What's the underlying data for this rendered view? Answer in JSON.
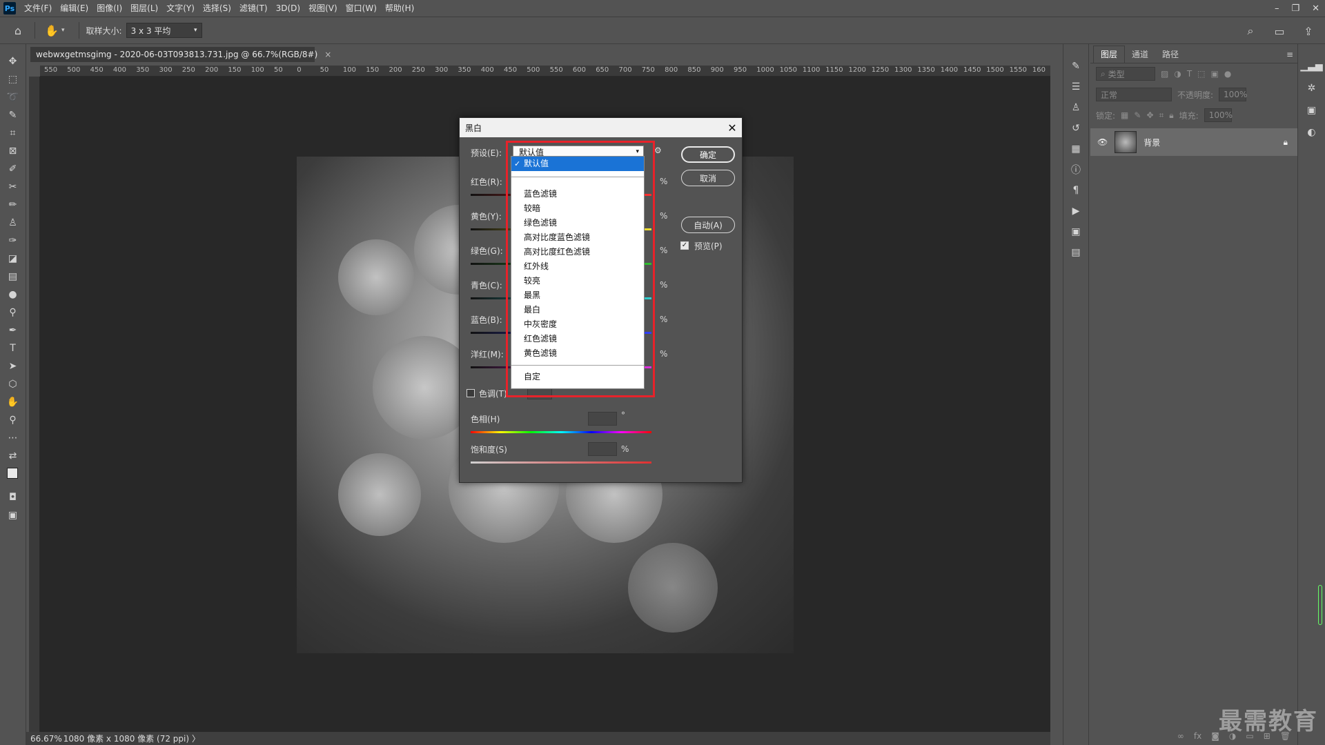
{
  "app": {
    "logo": "Ps",
    "menus": [
      "文件(F)",
      "编辑(E)",
      "图像(I)",
      "图层(L)",
      "文字(Y)",
      "选择(S)",
      "滤镜(T)",
      "3D(D)",
      "视图(V)",
      "窗口(W)",
      "帮助(H)"
    ]
  },
  "options": {
    "sample_size_label": "取样大小:",
    "sample_size_value": "3 x 3 平均"
  },
  "document": {
    "tab_title": "webwxgetmsgimg - 2020-06-03T093813.731.jpg @ 66.7%(RGB/8#)",
    "close_glyph": "×",
    "ruler_ticks": [
      "550",
      "500",
      "450",
      "400",
      "350",
      "300",
      "250",
      "200",
      "150",
      "100",
      "50",
      "0",
      "50",
      "100",
      "150",
      "200",
      "250",
      "300",
      "350",
      "400",
      "450",
      "500",
      "550",
      "600",
      "650",
      "700",
      "750",
      "800",
      "850",
      "900",
      "950",
      "1000",
      "1050",
      "1100",
      "1150",
      "1200",
      "1250",
      "1300",
      "1350",
      "1400",
      "1450",
      "1500",
      "1550",
      "160"
    ]
  },
  "status": {
    "zoom": "66.67%",
    "size": "1080 像素 x 1080 像素 (72 ppi)",
    "arrow": "〉"
  },
  "layers_panel": {
    "tabs": [
      "图层",
      "通道",
      "路径"
    ],
    "filter_label": "类型",
    "blend_mode": "正常",
    "opacity_label": "不透明度:",
    "opacity_value": "100%",
    "lock_label": "锁定:",
    "fill_label": "填充:",
    "fill_value": "100%",
    "layer_name": "背景"
  },
  "dialog": {
    "title": "黑白",
    "preset_label": "预设(E):",
    "preset_value": "默认值",
    "sliders": [
      {
        "label": "红色(R):",
        "color": "#ff3030"
      },
      {
        "label": "黄色(Y):",
        "color": "#f0e030"
      },
      {
        "label": "绿色(G):",
        "color": "#30c030"
      },
      {
        "label": "青色(C):",
        "color": "#30d0d0"
      },
      {
        "label": "蓝色(B):",
        "color": "#3040ff"
      },
      {
        "label": "洋红(M):",
        "color": "#e030e0"
      }
    ],
    "percent": "%",
    "degree": "°",
    "ok": "确定",
    "cancel": "取消",
    "auto": "自动(A)",
    "preview": "预览(P)",
    "tint": "色调(T)",
    "hue": "色相(H)",
    "saturation": "饱和度(S)"
  },
  "dropdown": {
    "selected": "默认值",
    "items": [
      "蓝色滤镜",
      "较暗",
      "绿色滤镜",
      "高对比度蓝色滤镜",
      "高对比度红色滤镜",
      "红外线",
      "较亮",
      "最黑",
      "最白",
      "中灰密度",
      "红色滤镜",
      "黄色滤镜"
    ],
    "custom": "自定"
  },
  "watermark": "最需教育",
  "colors": {
    "highlight": "#e8222a",
    "selected_item": "#1a73d6"
  }
}
